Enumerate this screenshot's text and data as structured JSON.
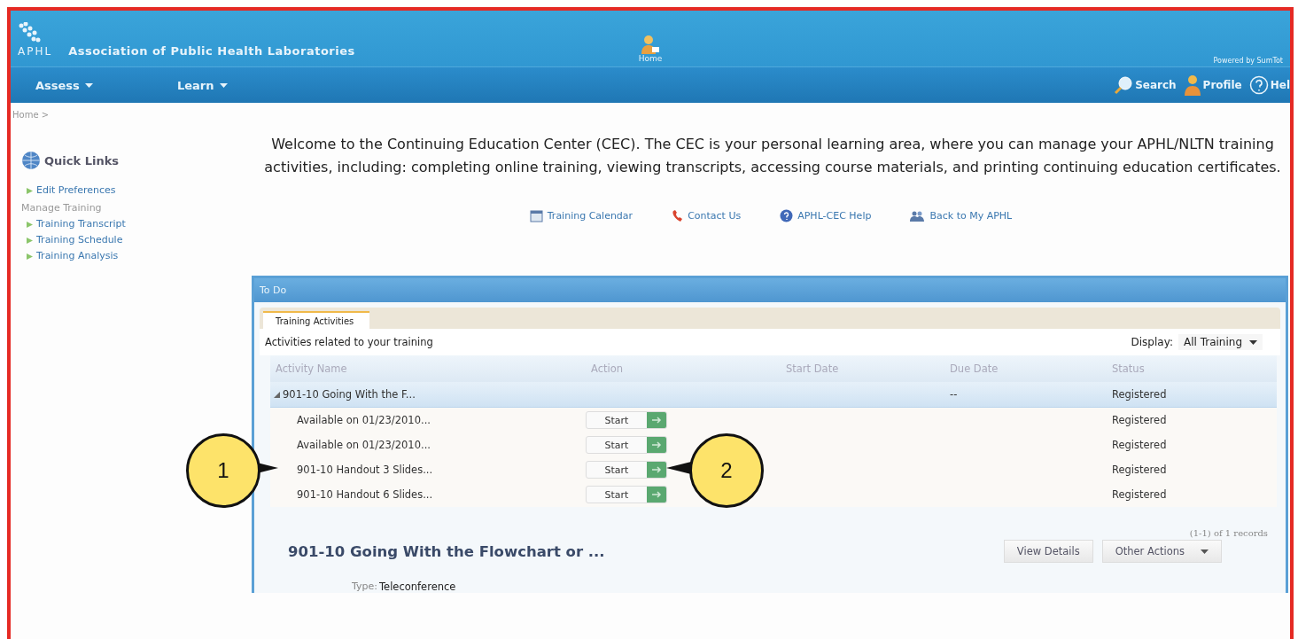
{
  "header": {
    "logo_text": "APHL",
    "org_name": "Association of Public Health Laboratories",
    "home_label": "Home",
    "powered_by": "Powered by SumTot",
    "nav": [
      {
        "label": "Assess"
      },
      {
        "label": "Learn"
      }
    ],
    "tools": [
      {
        "label": "Search",
        "kind": "search"
      },
      {
        "label": "Profile",
        "kind": "profile"
      },
      {
        "label": "Hel",
        "kind": "help"
      }
    ]
  },
  "breadcrumb": "Home >",
  "sidebar": {
    "title": "Quick Links",
    "items": [
      {
        "label": "Edit Preferences",
        "kind": "link"
      },
      {
        "label": "Manage Training",
        "kind": "heading"
      },
      {
        "label": "Training Transcript",
        "kind": "link"
      },
      {
        "label": "Training Schedule",
        "kind": "link"
      },
      {
        "label": "Training Analysis",
        "kind": "link"
      }
    ]
  },
  "welcome": "Welcome to the Continuing Education Center (CEC). The CEC is your personal learning area, where you can manage your APHL/NLTN training activities, including: completing online training, viewing transcripts, accessing course materials, and printing continuing education certificates.",
  "links": [
    {
      "label": "Training Calendar",
      "kind": "calendar"
    },
    {
      "label": "Contact Us",
      "kind": "phone"
    },
    {
      "label": "APHL-CEC Help",
      "kind": "help"
    },
    {
      "label": "Back to My APHL",
      "kind": "back"
    }
  ],
  "todo": {
    "title": "To Do",
    "tabs": [
      {
        "label": "Training Activities",
        "selected": true
      }
    ],
    "caption": "Activities related to your training",
    "display_label": "Display:",
    "display_value": "All Training",
    "columns": [
      "Activity Name",
      "Action",
      "Start Date",
      "Due Date",
      "Status"
    ],
    "group": {
      "name": "901-10 Going With the F...",
      "expanded": true,
      "due": "--",
      "status": "Registered"
    },
    "rows": [
      {
        "name": "Available on 01/23/2010...",
        "action": "Start",
        "status": "Registered"
      },
      {
        "name": "Available on 01/23/2010...",
        "action": "Start",
        "status": "Registered"
      },
      {
        "name": "901-10 Handout 3 Slides...",
        "action": "Start",
        "status": "Registered"
      },
      {
        "name": "901-10 Handout 6 Slides...",
        "action": "Start",
        "status": "Registered"
      }
    ],
    "records": "(1-1) of 1 records",
    "detail_title": "901-10 Going With the Flowchart or ...",
    "buttons": [
      {
        "label": "View Details",
        "kind": "plain"
      },
      {
        "label": "Other Actions",
        "kind": "dropdown"
      }
    ],
    "type_label": "Type:",
    "type_value": "Teleconference"
  },
  "callouts": [
    {
      "label": "1"
    },
    {
      "label": "2"
    }
  ]
}
